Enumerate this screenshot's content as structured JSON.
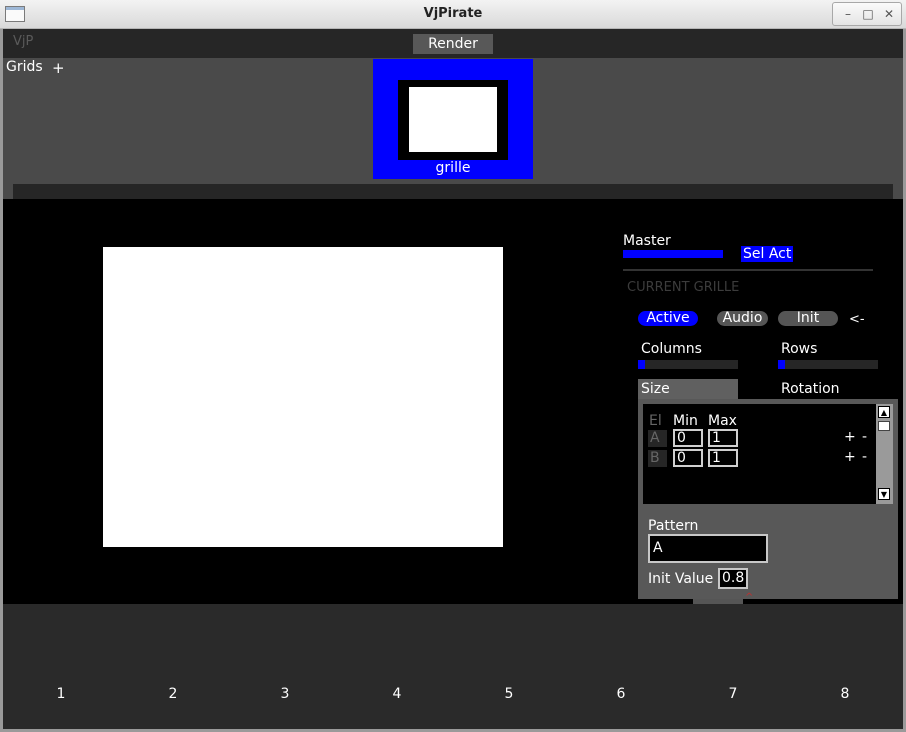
{
  "window": {
    "title": "VjPirate",
    "minimize": "–",
    "maximize": "□",
    "close": "✕"
  },
  "topbar": {
    "logo": "VjP",
    "render_label": "Render"
  },
  "grids": {
    "label": "Grids",
    "add_label": "+",
    "items": [
      {
        "label": "grille"
      }
    ]
  },
  "panel": {
    "master_label": "Master",
    "master_level": 1.0,
    "sel_act_label": "Sel Act",
    "current_grille_label": "CURRENT GRILLE",
    "active_label": "Active",
    "audio_label": "Audio",
    "init_label": "Init",
    "back_label": "<-",
    "columns_label": "Columns",
    "columns_level": 0.07,
    "rows_label": "Rows",
    "rows_level": 0.07,
    "size_tab": "Size",
    "rotation_tab": "Rotation",
    "table": {
      "headers": {
        "el": "El",
        "min": "Min",
        "max": "Max"
      },
      "rows": [
        {
          "key": "A",
          "min": "0",
          "max": "1",
          "plus": "+",
          "minus": "-"
        },
        {
          "key": "B",
          "min": "0",
          "max": "1",
          "plus": "+",
          "minus": "-"
        }
      ]
    },
    "scroll_up": "▲",
    "scroll_down": "▼",
    "pattern_label": "Pattern",
    "pattern_value": "A",
    "init_value_label": "Init Value",
    "init_value": "0.8"
  },
  "slots": [
    "1",
    "2",
    "3",
    "4",
    "5",
    "6",
    "7",
    "8"
  ],
  "colors": {
    "accent": "#0000ff",
    "background": "#2a2a2a",
    "panel": "#585858"
  }
}
